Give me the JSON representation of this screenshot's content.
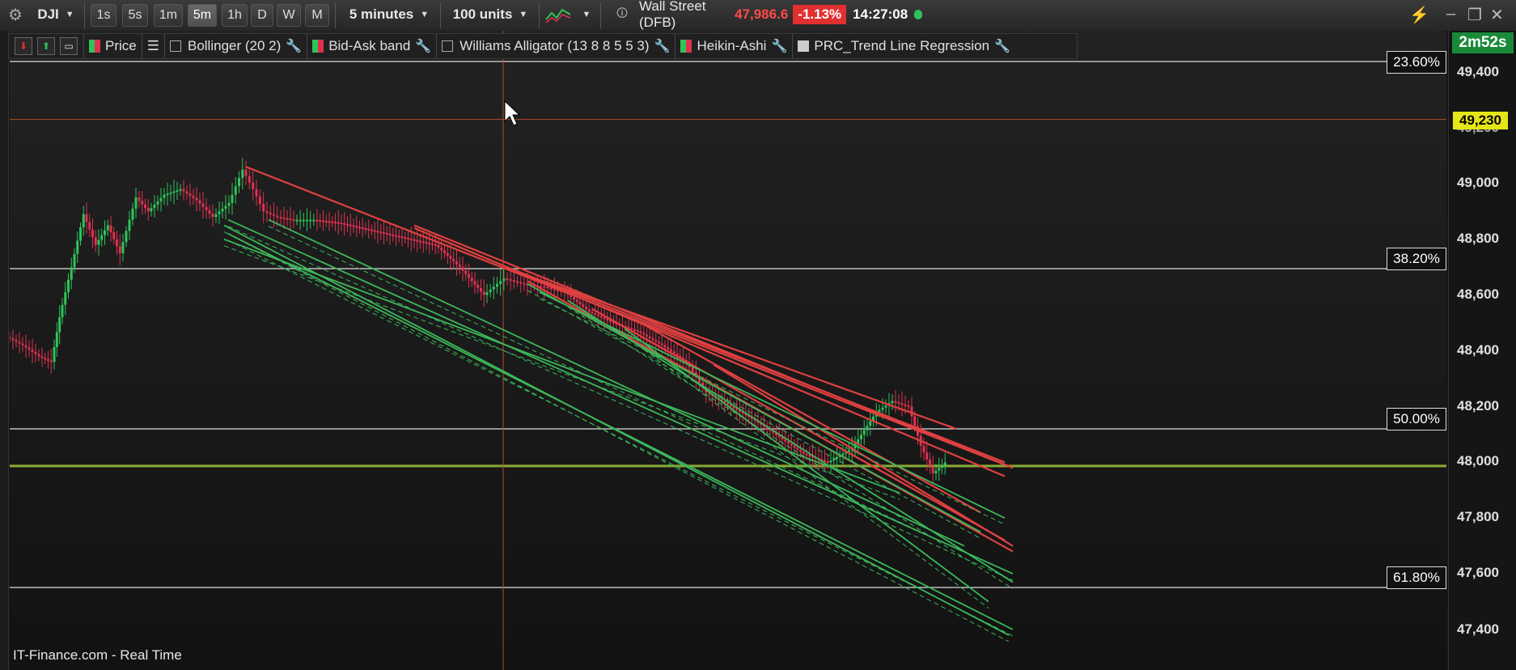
{
  "toolbar": {
    "symbol": "DJI",
    "timeframes": [
      "1s",
      "5s",
      "1m",
      "5m",
      "1h",
      "D",
      "W",
      "M"
    ],
    "active_timeframe": "5m",
    "interval": "5 minutes",
    "units": "100 units",
    "instrument_name": "Wall Street (DFB)",
    "last_price": "47,986.6",
    "change_pct": "-1.13%",
    "clock": "14:27:08"
  },
  "indicators": [
    {
      "label": "Price",
      "color": "#e03050",
      "color2": "#2ec45a",
      "checkbox": false
    },
    {
      "label": "Bollinger (20 2)",
      "checkbox": true
    },
    {
      "label": "Bid-Ask band",
      "color": "#e03050",
      "color2": "#2ec45a",
      "checkbox": false
    },
    {
      "label": "Williams Alligator (13 8 8 5 5 3)",
      "checkbox": true
    },
    {
      "label": "Heikin-Ashi",
      "color": "#e03050",
      "color2": "#2ec45a",
      "checkbox": false
    },
    {
      "label": "PRC_Trend Line Regression",
      "color": "#cccccc",
      "checkbox": false
    }
  ],
  "price_axis": {
    "ticks": [
      "49,400",
      "49,200",
      "49,000",
      "48,800",
      "48,600",
      "48,400",
      "48,200",
      "48,000",
      "47,800",
      "47,600",
      "47,400"
    ],
    "crosshair_price": "49,230",
    "countdown": "2m52s"
  },
  "fib_levels": [
    "23.60%",
    "38.20%",
    "50.00%",
    "61.80%"
  ],
  "footer": "IT-Finance.com - Real Time",
  "colors": {
    "up": "#2ec45a",
    "down": "#e03050",
    "trend_red": "#e04040",
    "trend_green": "#3cb85a",
    "crosshair": "#b84a2a"
  }
}
